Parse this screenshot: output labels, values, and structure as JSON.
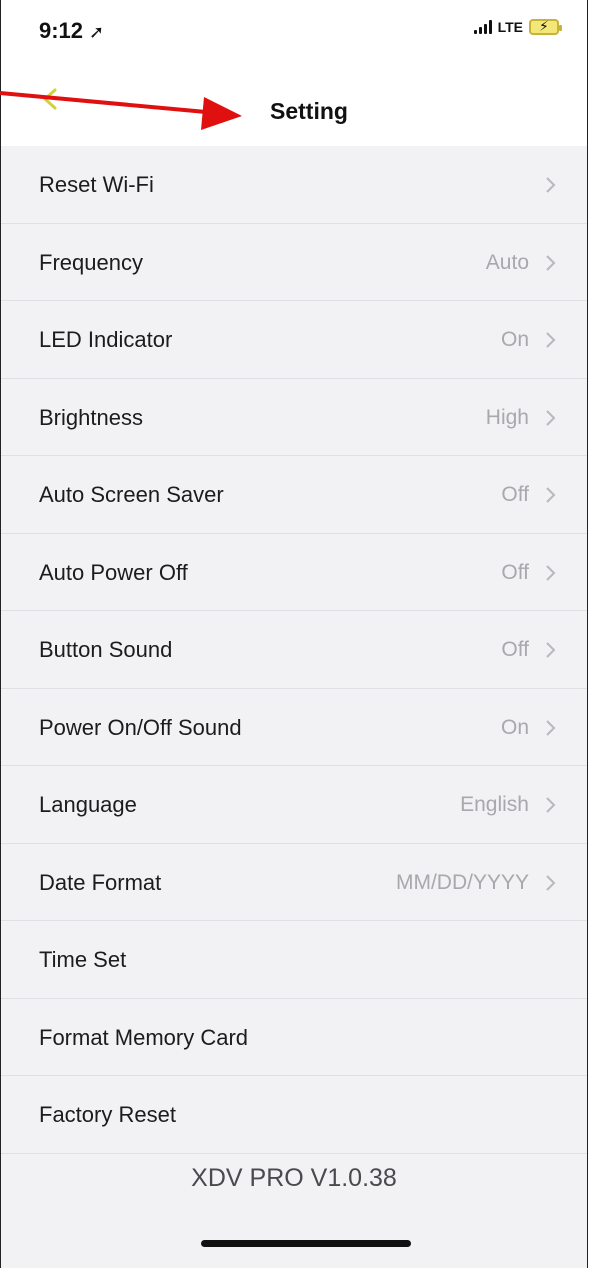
{
  "status": {
    "time": "9:12",
    "network": "LTE"
  },
  "nav": {
    "title": "Setting"
  },
  "settings": [
    {
      "label": "Reset Wi-Fi",
      "value": "",
      "chevron": true
    },
    {
      "label": "Frequency",
      "value": "Auto",
      "chevron": true
    },
    {
      "label": "LED Indicator",
      "value": "On",
      "chevron": true
    },
    {
      "label": "Brightness",
      "value": "High",
      "chevron": true
    },
    {
      "label": "Auto Screen Saver",
      "value": "Off",
      "chevron": true
    },
    {
      "label": "Auto Power Off",
      "value": "Off",
      "chevron": true
    },
    {
      "label": "Button Sound",
      "value": "Off",
      "chevron": true
    },
    {
      "label": "Power On/Off Sound",
      "value": "On",
      "chevron": true
    },
    {
      "label": "Language",
      "value": "English",
      "chevron": true
    },
    {
      "label": "Date Format",
      "value": "MM/DD/YYYY",
      "chevron": true
    },
    {
      "label": "Time Set",
      "value": "",
      "chevron": false
    },
    {
      "label": "Format Memory Card",
      "value": "",
      "chevron": false
    },
    {
      "label": "Factory Reset",
      "value": "",
      "chevron": false
    }
  ],
  "footer": {
    "version": "XDV PRO V1.0.38"
  },
  "colors": {
    "back_icon": "#d6cf3c",
    "annotation_arrow": "#e01010",
    "row_background": "#f2f2f4"
  }
}
